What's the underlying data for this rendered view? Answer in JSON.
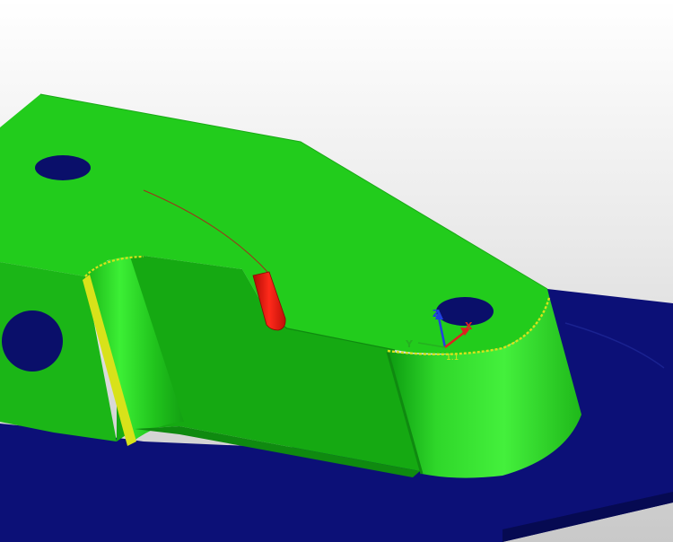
{
  "viewport": {
    "background_top": "#ffffff",
    "background_bottom": "#c9c9c9"
  },
  "colors": {
    "part_top": "#22cc1c",
    "part_side": "#15a912",
    "part_shadow": "#0f8a10",
    "fillet_highlight": "#3bef36",
    "base_plate": "#0c1077",
    "base_plate_edge": "#060a52",
    "hole": "#0a0f6a",
    "selected_feature": "#e0180c",
    "selected_edge": "#d8e21a",
    "axis_x": "#e02020",
    "axis_y": "#25b020",
    "axis_z": "#2040e0"
  },
  "triad": {
    "x_label": "X",
    "y_label": "Y",
    "z_label": "Z",
    "origin_label": "1.1"
  }
}
